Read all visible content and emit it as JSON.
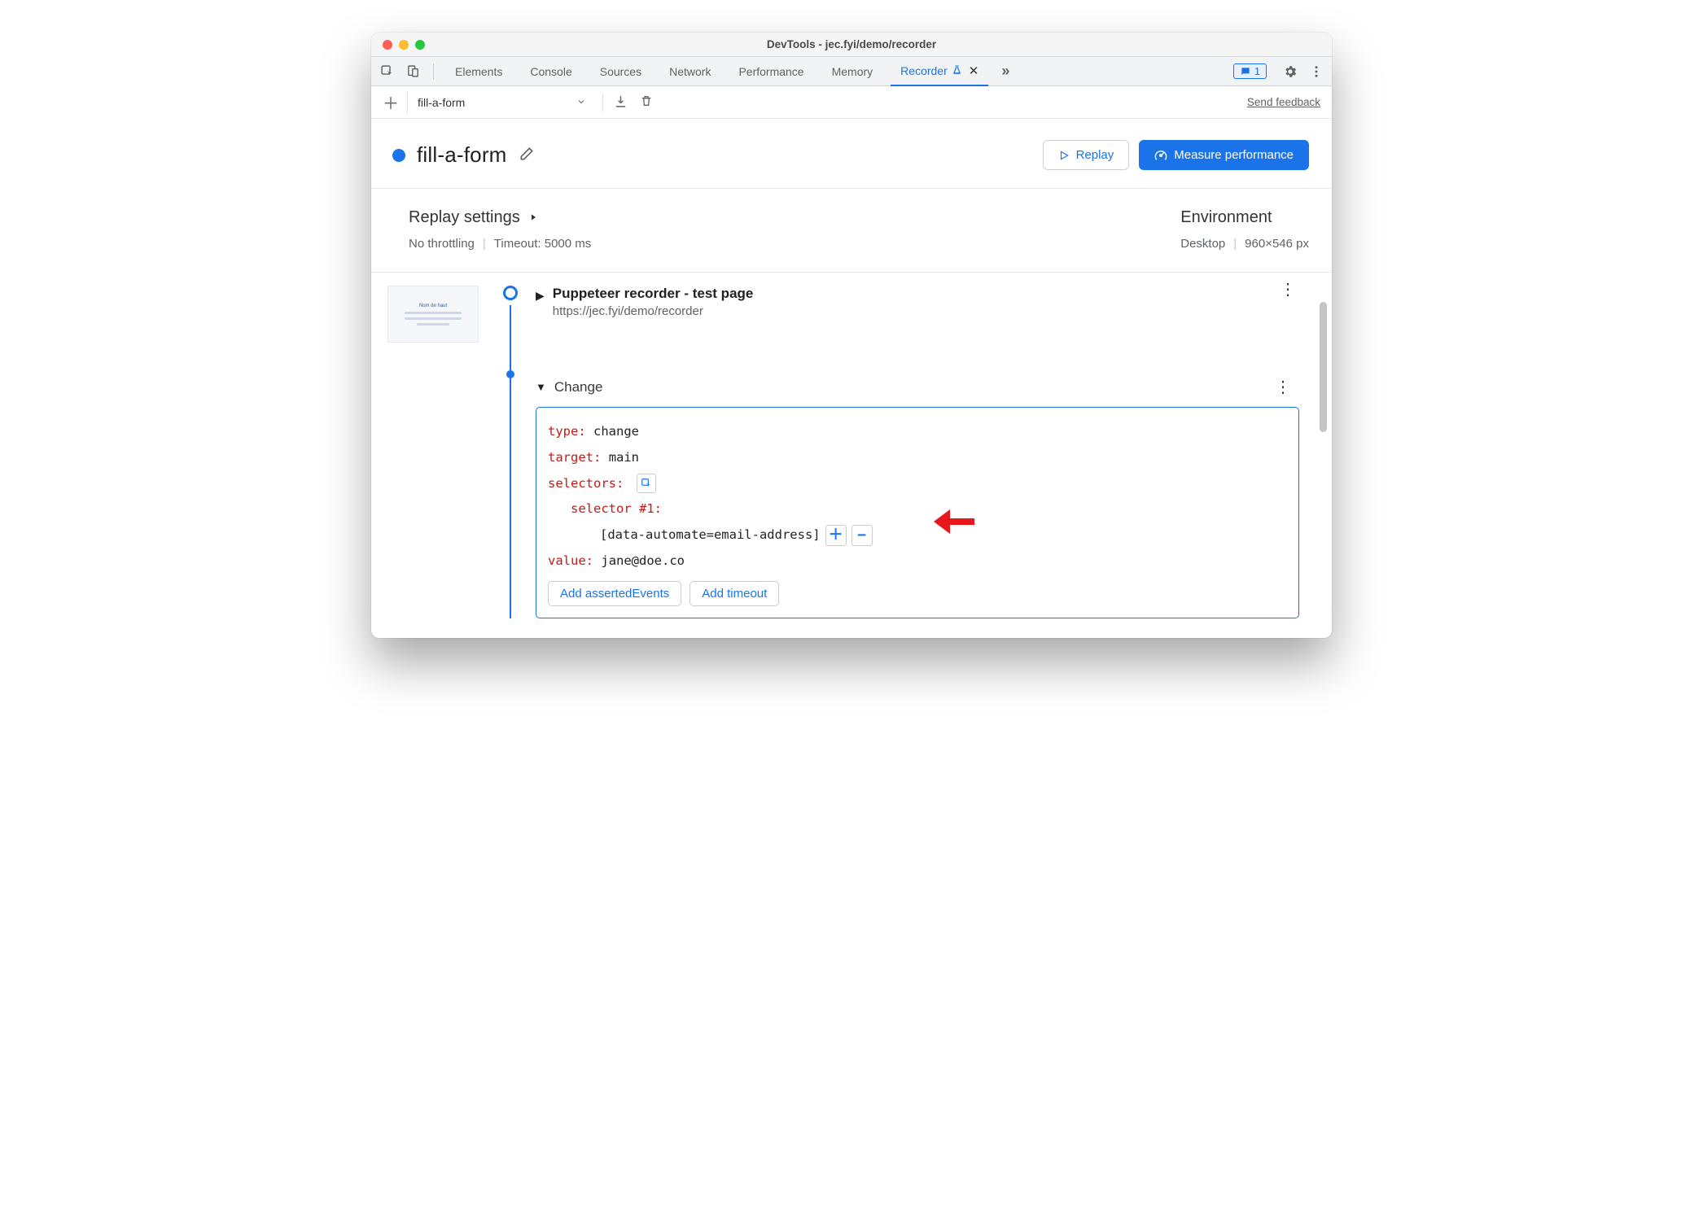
{
  "window": {
    "title": "DevTools - jec.fyi/demo/recorder"
  },
  "tabs": {
    "items": [
      "Elements",
      "Console",
      "Sources",
      "Network",
      "Performance",
      "Memory"
    ],
    "active": "Recorder",
    "issues_count": "1"
  },
  "toolbar": {
    "recording_name": "fill-a-form",
    "feedback": "Send feedback"
  },
  "header": {
    "recording_name": "fill-a-form",
    "replay_label": "Replay",
    "measure_label": "Measure performance"
  },
  "settings": {
    "replay_title": "Replay settings",
    "throttling": "No throttling",
    "timeout": "Timeout: 5000 ms",
    "env_title": "Environment",
    "device": "Desktop",
    "dimensions": "960×546 px"
  },
  "steps": {
    "start": {
      "title": "Puppeteer recorder - test page",
      "url": "https://jec.fyi/demo/recorder"
    },
    "change": {
      "label": "Change",
      "props": {
        "type_key": "type",
        "type_val": "change",
        "target_key": "target",
        "target_val": "main",
        "selectors_key": "selectors",
        "sel1_key": "selector #1",
        "sel1_val": "[data-automate=email-address]",
        "value_key": "value",
        "value_val": "jane@doe.co"
      },
      "add_asserted": "Add assertedEvents",
      "add_timeout": "Add timeout"
    }
  }
}
